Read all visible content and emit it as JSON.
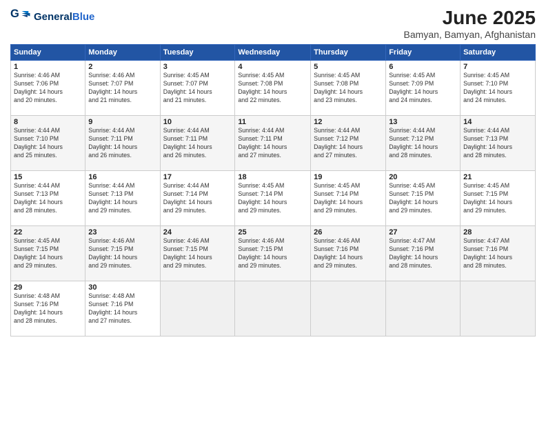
{
  "header": {
    "logo_general": "General",
    "logo_blue": "Blue",
    "month": "June 2025",
    "location": "Bamyan, Bamyan, Afghanistan"
  },
  "weekdays": [
    "Sunday",
    "Monday",
    "Tuesday",
    "Wednesday",
    "Thursday",
    "Friday",
    "Saturday"
  ],
  "weeks": [
    [
      {
        "day": "1",
        "info": "Sunrise: 4:46 AM\nSunset: 7:06 PM\nDaylight: 14 hours\nand 20 minutes."
      },
      {
        "day": "2",
        "info": "Sunrise: 4:46 AM\nSunset: 7:07 PM\nDaylight: 14 hours\nand 21 minutes."
      },
      {
        "day": "3",
        "info": "Sunrise: 4:45 AM\nSunset: 7:07 PM\nDaylight: 14 hours\nand 21 minutes."
      },
      {
        "day": "4",
        "info": "Sunrise: 4:45 AM\nSunset: 7:08 PM\nDaylight: 14 hours\nand 22 minutes."
      },
      {
        "day": "5",
        "info": "Sunrise: 4:45 AM\nSunset: 7:08 PM\nDaylight: 14 hours\nand 23 minutes."
      },
      {
        "day": "6",
        "info": "Sunrise: 4:45 AM\nSunset: 7:09 PM\nDaylight: 14 hours\nand 24 minutes."
      },
      {
        "day": "7",
        "info": "Sunrise: 4:45 AM\nSunset: 7:10 PM\nDaylight: 14 hours\nand 24 minutes."
      }
    ],
    [
      {
        "day": "8",
        "info": "Sunrise: 4:44 AM\nSunset: 7:10 PM\nDaylight: 14 hours\nand 25 minutes."
      },
      {
        "day": "9",
        "info": "Sunrise: 4:44 AM\nSunset: 7:11 PM\nDaylight: 14 hours\nand 26 minutes."
      },
      {
        "day": "10",
        "info": "Sunrise: 4:44 AM\nSunset: 7:11 PM\nDaylight: 14 hours\nand 26 minutes."
      },
      {
        "day": "11",
        "info": "Sunrise: 4:44 AM\nSunset: 7:11 PM\nDaylight: 14 hours\nand 27 minutes."
      },
      {
        "day": "12",
        "info": "Sunrise: 4:44 AM\nSunset: 7:12 PM\nDaylight: 14 hours\nand 27 minutes."
      },
      {
        "day": "13",
        "info": "Sunrise: 4:44 AM\nSunset: 7:12 PM\nDaylight: 14 hours\nand 28 minutes."
      },
      {
        "day": "14",
        "info": "Sunrise: 4:44 AM\nSunset: 7:13 PM\nDaylight: 14 hours\nand 28 minutes."
      }
    ],
    [
      {
        "day": "15",
        "info": "Sunrise: 4:44 AM\nSunset: 7:13 PM\nDaylight: 14 hours\nand 28 minutes."
      },
      {
        "day": "16",
        "info": "Sunrise: 4:44 AM\nSunset: 7:13 PM\nDaylight: 14 hours\nand 29 minutes."
      },
      {
        "day": "17",
        "info": "Sunrise: 4:44 AM\nSunset: 7:14 PM\nDaylight: 14 hours\nand 29 minutes."
      },
      {
        "day": "18",
        "info": "Sunrise: 4:45 AM\nSunset: 7:14 PM\nDaylight: 14 hours\nand 29 minutes."
      },
      {
        "day": "19",
        "info": "Sunrise: 4:45 AM\nSunset: 7:14 PM\nDaylight: 14 hours\nand 29 minutes."
      },
      {
        "day": "20",
        "info": "Sunrise: 4:45 AM\nSunset: 7:15 PM\nDaylight: 14 hours\nand 29 minutes."
      },
      {
        "day": "21",
        "info": "Sunrise: 4:45 AM\nSunset: 7:15 PM\nDaylight: 14 hours\nand 29 minutes."
      }
    ],
    [
      {
        "day": "22",
        "info": "Sunrise: 4:45 AM\nSunset: 7:15 PM\nDaylight: 14 hours\nand 29 minutes."
      },
      {
        "day": "23",
        "info": "Sunrise: 4:46 AM\nSunset: 7:15 PM\nDaylight: 14 hours\nand 29 minutes."
      },
      {
        "day": "24",
        "info": "Sunrise: 4:46 AM\nSunset: 7:15 PM\nDaylight: 14 hours\nand 29 minutes."
      },
      {
        "day": "25",
        "info": "Sunrise: 4:46 AM\nSunset: 7:15 PM\nDaylight: 14 hours\nand 29 minutes."
      },
      {
        "day": "26",
        "info": "Sunrise: 4:46 AM\nSunset: 7:16 PM\nDaylight: 14 hours\nand 29 minutes."
      },
      {
        "day": "27",
        "info": "Sunrise: 4:47 AM\nSunset: 7:16 PM\nDaylight: 14 hours\nand 28 minutes."
      },
      {
        "day": "28",
        "info": "Sunrise: 4:47 AM\nSunset: 7:16 PM\nDaylight: 14 hours\nand 28 minutes."
      }
    ],
    [
      {
        "day": "29",
        "info": "Sunrise: 4:48 AM\nSunset: 7:16 PM\nDaylight: 14 hours\nand 28 minutes."
      },
      {
        "day": "30",
        "info": "Sunrise: 4:48 AM\nSunset: 7:16 PM\nDaylight: 14 hours\nand 27 minutes."
      },
      {
        "day": "",
        "info": ""
      },
      {
        "day": "",
        "info": ""
      },
      {
        "day": "",
        "info": ""
      },
      {
        "day": "",
        "info": ""
      },
      {
        "day": "",
        "info": ""
      }
    ]
  ]
}
